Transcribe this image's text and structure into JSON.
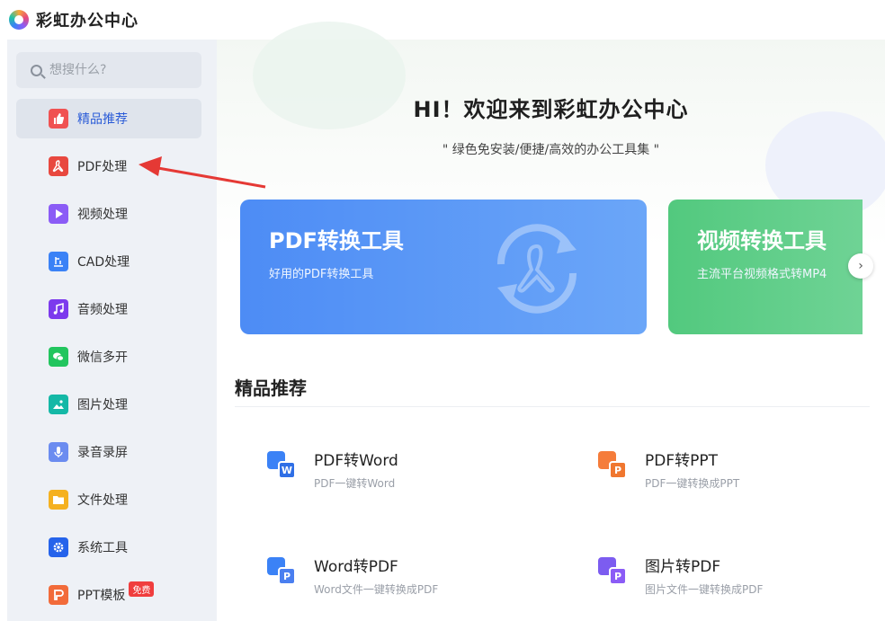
{
  "app": {
    "title": "彩虹办公中心"
  },
  "search": {
    "placeholder": "想搜什么?"
  },
  "sidebar": {
    "items": [
      {
        "label": "精品推荐",
        "icon": "thumbs-up-icon",
        "color": "#f05252",
        "active": true
      },
      {
        "label": "PDF处理",
        "icon": "pdf-icon",
        "color": "#e8483f"
      },
      {
        "label": "视频处理",
        "icon": "video-icon",
        "color": "#8b5cf6"
      },
      {
        "label": "CAD处理",
        "icon": "cad-icon",
        "color": "#3b82f6"
      },
      {
        "label": "音频处理",
        "icon": "music-icon",
        "color": "#7c3aed"
      },
      {
        "label": "微信多开",
        "icon": "wechat-icon",
        "color": "#22c55e"
      },
      {
        "label": "图片处理",
        "icon": "image-icon",
        "color": "#14b8a6"
      },
      {
        "label": "录音录屏",
        "icon": "microphone-icon",
        "color": "#6b8cf0"
      },
      {
        "label": "文件处理",
        "icon": "folder-icon",
        "color": "#f5b120"
      },
      {
        "label": "系统工具",
        "icon": "gear-icon",
        "color": "#2563eb"
      },
      {
        "label": "PPT模板",
        "icon": "ppt-icon",
        "color": "#f26b3a",
        "badge": "免费"
      }
    ]
  },
  "hero": {
    "title": "HI！欢迎来到彩虹办公中心",
    "subtitle": "\" 绿色免安装/便捷/高效的办公工具集 \""
  },
  "banners": [
    {
      "title": "PDF转换工具",
      "subtitle": "好用的PDF转换工具",
      "color": "#4d8cf5"
    },
    {
      "title": "视频转换工具",
      "subtitle": "主流平台视频格式转MP4",
      "color": "#52c97e"
    }
  ],
  "section": {
    "title": "精品推荐"
  },
  "tools": [
    {
      "name": "PDF转Word",
      "desc": "PDF一键转Word",
      "front_letter": "W",
      "back_color": "#3b82f6",
      "front_color": "#2f6fe6"
    },
    {
      "name": "PDF转PPT",
      "desc": "PDF一键转换成PPT",
      "front_letter": "P",
      "back_color": "#f57c3a",
      "front_color": "#f0772f"
    },
    {
      "name": "Word转PDF",
      "desc": "Word文件一键转换成PDF",
      "front_letter": "P",
      "back_color": "#3b82f6",
      "front_color": "#4a7ff0"
    },
    {
      "name": "图片转PDF",
      "desc": "图片文件一键转换成PDF",
      "front_letter": "P",
      "back_color": "#7c5cf0",
      "front_color": "#8b5cf6"
    }
  ]
}
